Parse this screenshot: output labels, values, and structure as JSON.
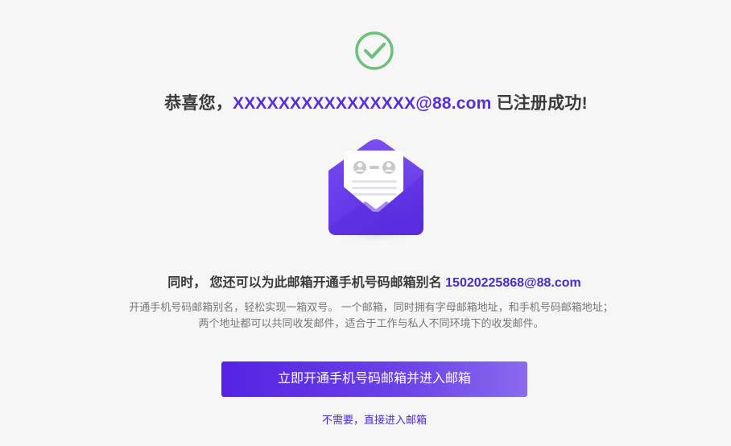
{
  "success_icon": {
    "icon": "check-circle-icon",
    "color": "#6cc07a"
  },
  "headline": {
    "prefix": "恭喜您，",
    "email": "XXXXXXXXXXXXXXXX@88.com",
    "suffix": " 已注册成功!"
  },
  "illustration": {
    "icon": "open-envelope-icon",
    "color": "#6a3de8"
  },
  "alias": {
    "prefix": "同时， 您还可以为此邮箱开通手机号码邮箱别名 ",
    "email": "15020225868@88.com"
  },
  "description": {
    "line1": "开通手机号码邮箱别名，轻松实现一箱双号。 一个邮箱，同时拥有字母邮箱地址，和手机号码邮箱地址；",
    "line2": "两个地址都可以共同收发邮件，适合于工作与私人不同环境下的收发邮件。"
  },
  "actions": {
    "primary_label": "立即开通手机号码邮箱并进入邮箱",
    "skip_label": "不需要，直接进入邮箱"
  },
  "colors": {
    "accent": "#5a2fd6",
    "button_start": "#5522e3",
    "button_end": "#8a6aef",
    "background": "#f6f6f6"
  }
}
